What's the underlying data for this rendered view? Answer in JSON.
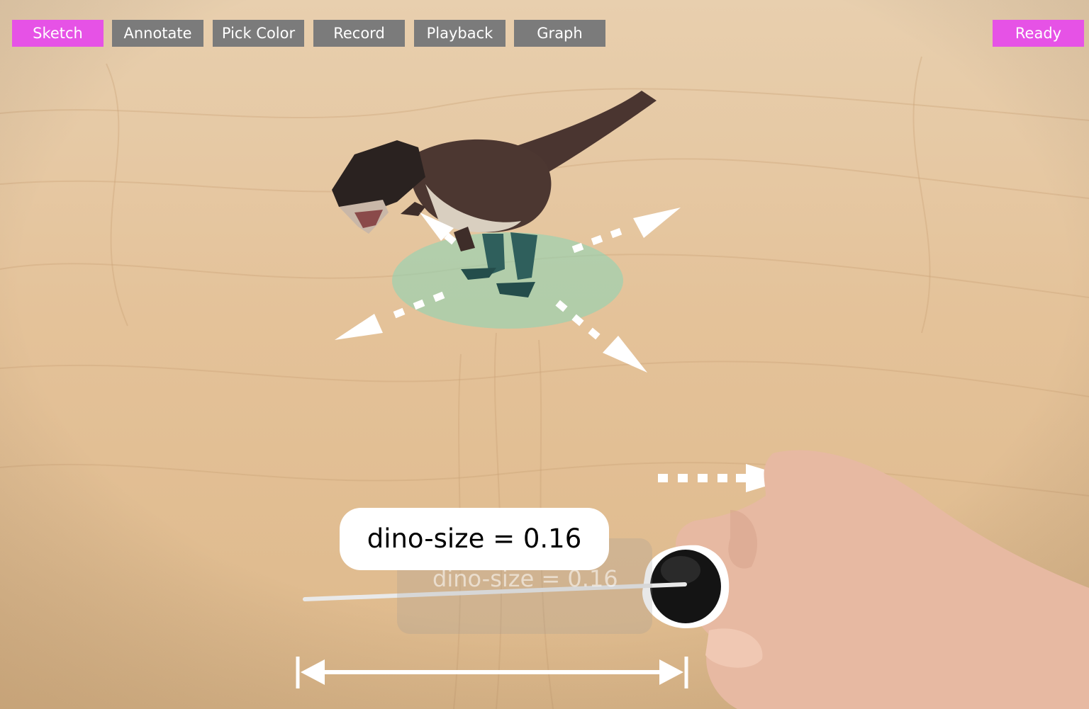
{
  "toolbar": {
    "buttons": [
      {
        "label": "Sketch",
        "state": "active"
      },
      {
        "label": "Annotate",
        "state": "inactive"
      },
      {
        "label": "Pick Color",
        "state": "inactive"
      },
      {
        "label": "Record",
        "state": "inactive"
      },
      {
        "label": "Playback",
        "state": "inactive"
      },
      {
        "label": "Graph",
        "state": "inactive"
      }
    ],
    "status_label": "Ready"
  },
  "scene": {
    "variable_label": "dino-size = 0.16",
    "ghost_label": "dino-size = 0.16",
    "model": "dinosaur",
    "colors": {
      "accent": "#e652e6",
      "button_gray": "#7b7b7b",
      "table_wood": "#e2bf94",
      "base_disc": "#8fd3b4",
      "dino_body": "#4a3530",
      "dino_legs": "#2f5f5c"
    }
  }
}
